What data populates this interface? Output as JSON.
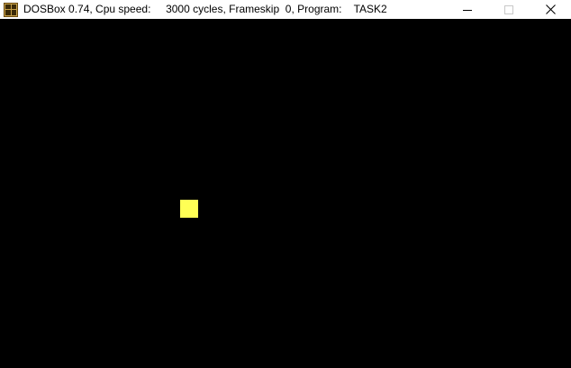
{
  "window": {
    "title": "DOSBox 0.74, Cpu speed:     3000 cycles, Frameskip  0, Program:    TASK2",
    "app_icon": "dosbox-icon",
    "controls": {
      "minimize_icon": "minimize-icon",
      "maximize_icon": "maximize-icon",
      "close_icon": "close-icon"
    }
  },
  "screen": {
    "background_color": "#000000",
    "sprite": {
      "shape": "square",
      "color": "#ffff55"
    }
  }
}
